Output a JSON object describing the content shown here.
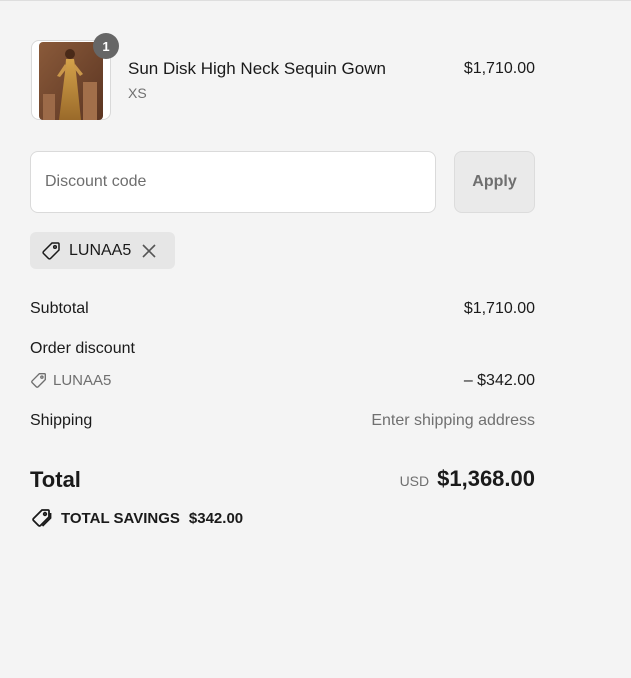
{
  "cart": {
    "item": {
      "name": "Sun Disk High Neck Sequin Gown",
      "variant": "XS",
      "price": "$1,710.00",
      "quantity": "1",
      "image_icon": "gown-product-image"
    }
  },
  "discount": {
    "placeholder": "Discount code",
    "value": "",
    "apply_label": "Apply",
    "applied_code": "LUNAA5"
  },
  "summary": {
    "subtotal_label": "Subtotal",
    "subtotal_value": "$1,710.00",
    "order_discount_label": "Order discount",
    "order_discount_code": "LUNAA5",
    "order_discount_value": "– $342.00",
    "shipping_label": "Shipping",
    "shipping_value": "Enter shipping address",
    "total_label": "Total",
    "currency": "USD",
    "total_value": "$1,368.00",
    "savings_label": "TOTAL SAVINGS",
    "savings_value": "$342.00"
  },
  "colors": {
    "background": "#f4f4f4",
    "badge": "#666666",
    "chip": "#e6e6e6",
    "muted_text": "#707070"
  }
}
